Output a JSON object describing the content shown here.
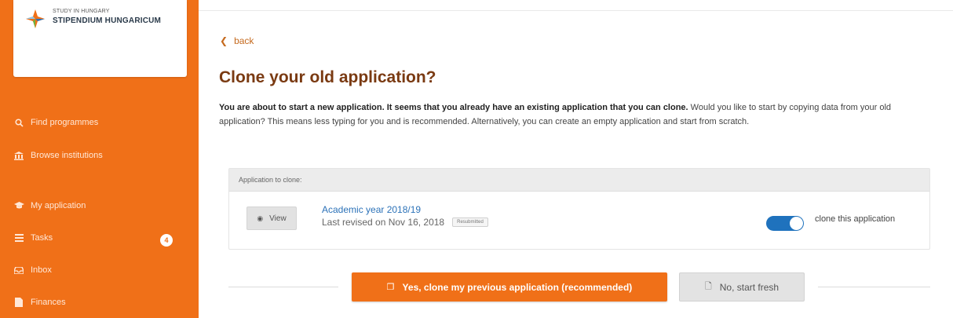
{
  "brand": {
    "line1": "STUDY IN HUNGARY",
    "line2": "STIPENDIUM HUNGARICUM",
    "colors": {
      "orange": "#f07018",
      "blue": "#2c72b8",
      "green": "#6db33f"
    }
  },
  "sidebar": {
    "items": [
      {
        "label": "Find programmes",
        "icon": "search-icon"
      },
      {
        "label": "Browse institutions",
        "icon": "institution-icon"
      },
      {
        "label": "My application",
        "icon": "graduation-cap-icon"
      },
      {
        "label": "Tasks",
        "icon": "list-icon",
        "badge": "4"
      },
      {
        "label": "Inbox",
        "icon": "inbox-icon"
      },
      {
        "label": "Finances",
        "icon": "document-icon"
      }
    ]
  },
  "main": {
    "back_label": "back",
    "title": "Clone your old application?",
    "desc_bold": "You are about to start a new application. It seems that you already have an existing application that you can clone.",
    "desc_rest": " Would you like to start by copying data from your old application? This means less typing for you and is recommended. Alternatively, you can create an empty application and start from scratch.",
    "panel": {
      "header": "Application to clone:",
      "view_label": "View",
      "app_title": "Academic year 2018/19",
      "app_revised": "Last revised on Nov 16, 2018",
      "tag": "Resubmitted",
      "toggle_on": true,
      "toggle_label": "clone this application"
    },
    "actions": {
      "yes_label": "Yes, clone my previous application (recommended)",
      "no_label": "No, start fresh"
    }
  }
}
